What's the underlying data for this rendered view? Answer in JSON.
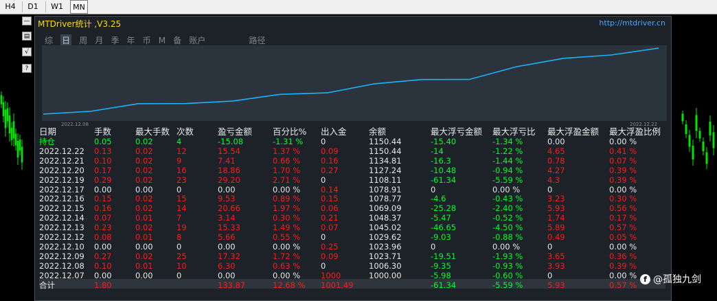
{
  "toolbar": {
    "timeframes": [
      "H4",
      "D1",
      "W1",
      "MN"
    ],
    "selected": "MN"
  },
  "side_buttons": [
    "—",
    "▤",
    "√",
    "?"
  ],
  "panel": {
    "title": "MTDriver统计 ,V3.25",
    "url": "http://mtdriver.cn",
    "tabs": [
      "综",
      "日",
      "周",
      "月",
      "季",
      "年",
      "币",
      "M",
      "备",
      "账户",
      "路径"
    ],
    "active_tab": "日",
    "start_date": "2022.12.08",
    "end_date": "2022.12.22",
    "columns": [
      "日期",
      "手数",
      "最大手数",
      "次数",
      "盈亏金额",
      "百分比%",
      "出入金",
      "余额",
      "最大浮亏金额",
      "最大浮亏比",
      "最大浮盈金额",
      "最大浮盈比例"
    ]
  },
  "chart_data": {
    "type": "line",
    "x": [
      "2022.12.07",
      "2022.12.08",
      "2022.12.09",
      "2022.12.10",
      "2022.12.12",
      "2022.12.13",
      "2022.12.14",
      "2022.12.15",
      "2022.12.16",
      "2022.12.17",
      "2022.12.19",
      "2022.12.20",
      "2022.12.21",
      "2022.12.22"
    ],
    "values": [
      1000.0,
      1006.3,
      1023.71,
      1023.96,
      1029.62,
      1045.02,
      1048.37,
      1069.09,
      1078.77,
      1078.91,
      1108.11,
      1127.24,
      1134.81,
      1150.44
    ],
    "line_color": "#1ab3ff",
    "grid": false
  },
  "rows": [
    {
      "c": [
        "持仓",
        "0.05",
        "0.02",
        "4",
        "-15.08",
        "-1.31 %",
        "0",
        "1150.44",
        "-15.40",
        "-1.34 %",
        "0.00",
        "0.00 %"
      ],
      "k": [
        "green",
        "green",
        "green",
        "green",
        "green",
        "green",
        "white",
        "white",
        "green",
        "green",
        "white",
        "white"
      ]
    },
    {
      "c": [
        "2022.12.22",
        "0.13",
        "0.02",
        "12",
        "15.54",
        "1.37 %",
        "0.09",
        "1150.44",
        "-14",
        "-1.22 %",
        "4.65",
        "0.41 %"
      ],
      "k": [
        "white",
        "red",
        "red",
        "red",
        "red",
        "red",
        "red",
        "white",
        "green",
        "green",
        "red",
        "red"
      ]
    },
    {
      "c": [
        "2022.12.21",
        "0.10",
        "0.02",
        "9",
        "7.41",
        "0.66 %",
        "0.16",
        "1134.81",
        "-16.3",
        "-1.44 %",
        "0.78",
        "0.07 %"
      ],
      "k": [
        "white",
        "red",
        "red",
        "red",
        "red",
        "red",
        "red",
        "white",
        "green",
        "green",
        "red",
        "red"
      ]
    },
    {
      "c": [
        "2022.12.20",
        "0.17",
        "0.02",
        "16",
        "18.86",
        "1.70 %",
        "0.27",
        "1127.24",
        "-10.48",
        "-0.94 %",
        "4.27",
        "0.39 %"
      ],
      "k": [
        "white",
        "red",
        "red",
        "red",
        "red",
        "red",
        "red",
        "white",
        "green",
        "green",
        "red",
        "red"
      ]
    },
    {
      "c": [
        "2022.12.19",
        "0.29",
        "0.02",
        "23",
        "29.20",
        "2.71 %",
        "0",
        "1108.11",
        "-61.34",
        "-5.59 %",
        "4.3",
        "0.39 %"
      ],
      "k": [
        "white",
        "red",
        "red",
        "red",
        "red",
        "red",
        "white",
        "white",
        "green",
        "green",
        "red",
        "red"
      ]
    },
    {
      "c": [
        "2022.12.17",
        "0.00",
        "0.00",
        "0",
        "0.00",
        "0.00 %",
        "0.14",
        "1078.91",
        "0",
        "0.00 %",
        "0",
        "0.00 %"
      ],
      "k": [
        "white",
        "white",
        "white",
        "white",
        "white",
        "white",
        "red",
        "white",
        "white",
        "white",
        "white",
        "white"
      ]
    },
    {
      "c": [
        "2022.12.16",
        "0.15",
        "0.02",
        "15",
        "9.53",
        "0.89 %",
        "0.15",
        "1078.77",
        "-4.6",
        "-0.43 %",
        "3.23",
        "0.30 %"
      ],
      "k": [
        "white",
        "red",
        "red",
        "red",
        "red",
        "red",
        "red",
        "white",
        "green",
        "green",
        "red",
        "red"
      ]
    },
    {
      "c": [
        "2022.12.15",
        "0.16",
        "0.02",
        "14",
        "20.66",
        "1.97 %",
        "0.06",
        "1069.09",
        "-25.28",
        "-2.40 %",
        "5.93",
        "0.56 %"
      ],
      "k": [
        "white",
        "red",
        "red",
        "red",
        "red",
        "red",
        "red",
        "white",
        "green",
        "green",
        "red",
        "red"
      ]
    },
    {
      "c": [
        "2022.12.14",
        "0.07",
        "0.01",
        "7",
        "3.14",
        "0.30 %",
        "0.21",
        "1048.37",
        "-5.47",
        "-0.52 %",
        "1.74",
        "0.17 %"
      ],
      "k": [
        "white",
        "red",
        "red",
        "red",
        "red",
        "red",
        "red",
        "white",
        "green",
        "green",
        "red",
        "red"
      ]
    },
    {
      "c": [
        "2022.12.13",
        "0.23",
        "0.02",
        "19",
        "15.33",
        "1.49 %",
        "0.07",
        "1045.02",
        "-46.65",
        "-4.50 %",
        "5.89",
        "0.57 %"
      ],
      "k": [
        "white",
        "red",
        "red",
        "red",
        "red",
        "red",
        "red",
        "white",
        "green",
        "green",
        "red",
        "red"
      ]
    },
    {
      "c": [
        "2022.12.12",
        "0.08",
        "0.01",
        "8",
        "5.66",
        "0.55 %",
        "0",
        "1029.62",
        "-9.03",
        "-0.88 %",
        "0.49",
        "0.05 %"
      ],
      "k": [
        "white",
        "red",
        "red",
        "red",
        "red",
        "red",
        "white",
        "white",
        "green",
        "green",
        "red",
        "red"
      ]
    },
    {
      "c": [
        "2022.12.10",
        "0.00",
        "0.00",
        "0",
        "0.00",
        "0.00 %",
        "0.25",
        "1023.96",
        "0",
        "0.00 %",
        "0",
        "0.00 %"
      ],
      "k": [
        "white",
        "white",
        "white",
        "white",
        "white",
        "white",
        "red",
        "white",
        "white",
        "white",
        "white",
        "white"
      ]
    },
    {
      "c": [
        "2022.12.09",
        "0.27",
        "0.02",
        "25",
        "17.32",
        "1.72 %",
        "0.09",
        "1023.71",
        "-19.51",
        "-1.93 %",
        "3.65",
        "0.36 %"
      ],
      "k": [
        "white",
        "red",
        "red",
        "red",
        "red",
        "red",
        "red",
        "white",
        "green",
        "green",
        "red",
        "red"
      ]
    },
    {
      "c": [
        "2022.12.08",
        "0.10",
        "0.01",
        "10",
        "6.30",
        "0.63 %",
        "0",
        "1006.30",
        "-9.35",
        "-0.93 %",
        "3.93",
        "0.39 %"
      ],
      "k": [
        "white",
        "red",
        "red",
        "red",
        "red",
        "red",
        "white",
        "white",
        "green",
        "green",
        "red",
        "red"
      ]
    },
    {
      "c": [
        "2022.12.07",
        "0.00",
        "0.00",
        "0",
        "0.00",
        "0.00 %",
        "1000",
        "1000.00",
        "-5.98",
        "-0.60 %",
        "0",
        "0.00 %"
      ],
      "k": [
        "white",
        "white",
        "white",
        "white",
        "white",
        "white",
        "red",
        "white",
        "green",
        "green",
        "white",
        "white"
      ]
    },
    {
      "c": [
        "合计",
        "1.80",
        "",
        "",
        "133.87",
        "12.68 %",
        "1001.49",
        "",
        "-61.34",
        "-5.59 %",
        "5.93",
        "0.57 %"
      ],
      "k": [
        "white",
        "red",
        "red",
        "red",
        "red",
        "red",
        "red",
        "white",
        "green",
        "green",
        "red",
        "red"
      ]
    }
  ],
  "watermark": {
    "icon": "f",
    "text": "@孤独九剑"
  }
}
